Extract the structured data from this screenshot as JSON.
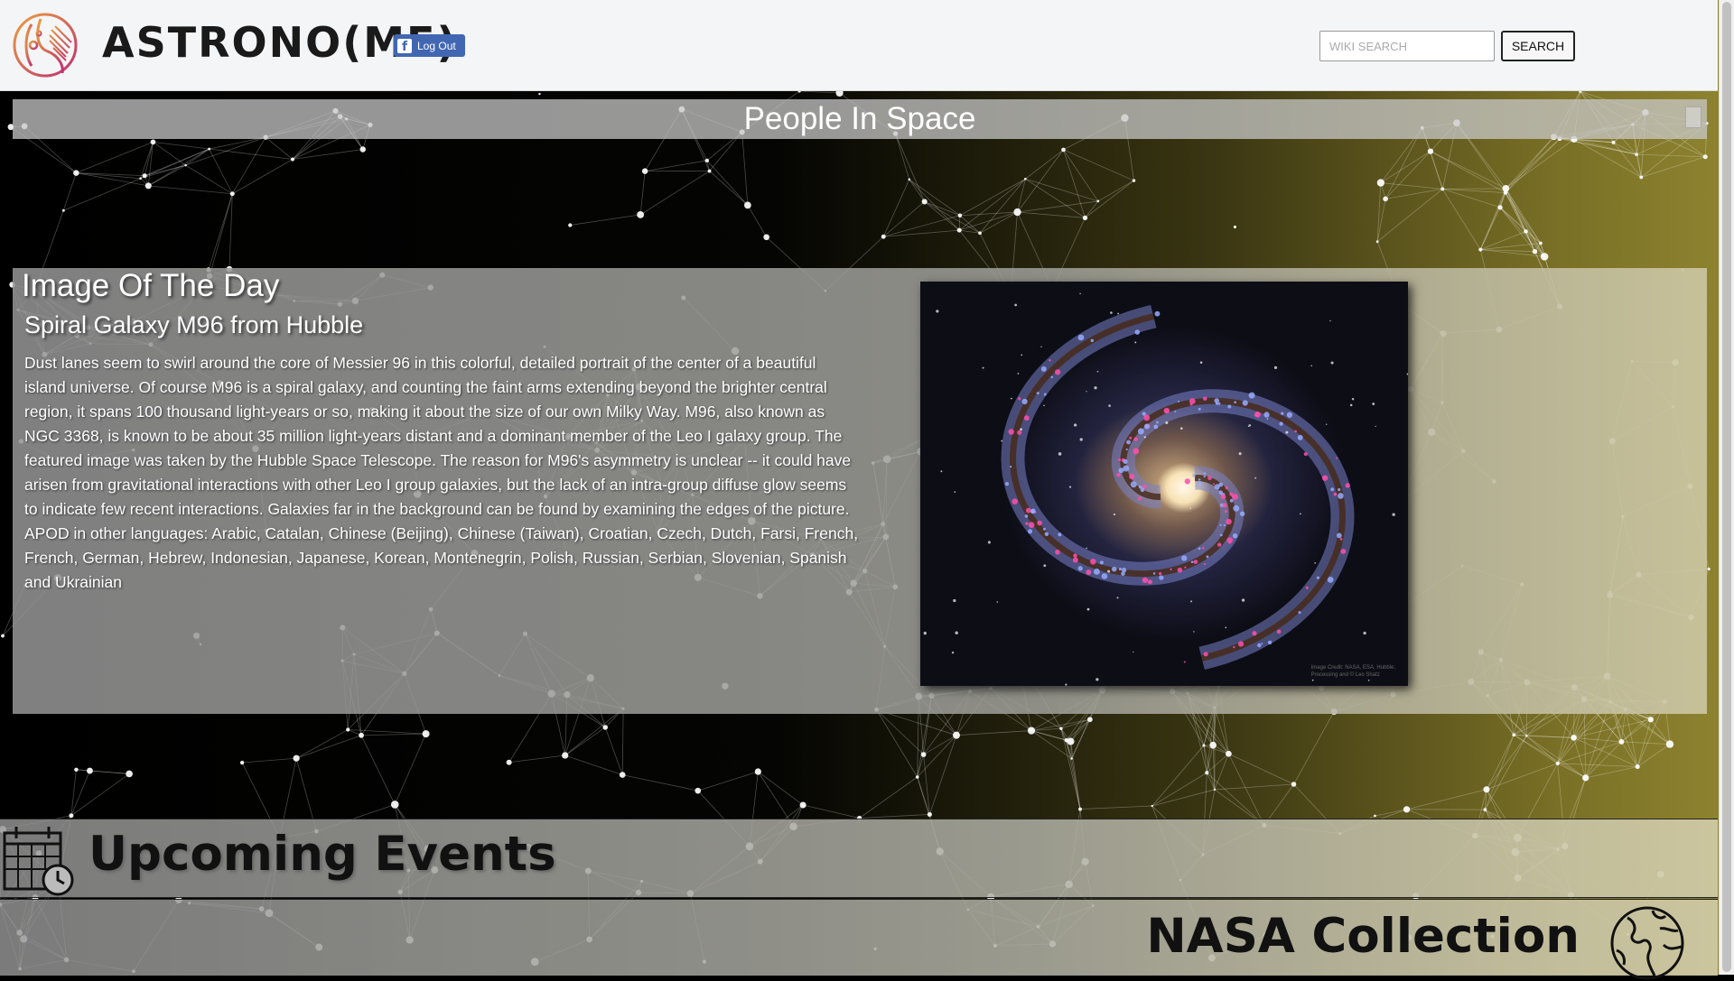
{
  "header": {
    "logo_icon": "planet-logo-icon",
    "brand": "ASTRONO(ME)",
    "facebook_button_label": "Log Out",
    "facebook_icon_glyph": "f",
    "search_placeholder": "WIKI SEARCH",
    "search_button_label": "SEARCH"
  },
  "people_in_space": {
    "title": "People In Space"
  },
  "image_of_the_day": {
    "heading": "Image Of The Day",
    "title": "Spiral Galaxy M96 from Hubble",
    "description": "Dust lanes seem to swirl around the core of Messier 96 in this colorful, detailed portrait of the center of a beautiful island universe. Of course M96 is a spiral galaxy, and counting the faint arms extending beyond the brighter central region, it spans 100 thousand light-years or so, making it about the size of our own Milky Way. M96, also known as NGC 3368, is known to be about 35 million light-years distant and a dominant member of the Leo I galaxy group. The featured image was taken by the Hubble Space Telescope. The reason for M96's asymmetry is unclear -- it could have arisen from gravitational interactions with other Leo I group galaxies, but the lack of an intra-group diffuse glow seems to indicate few recent interactions. Galaxies far in the background can be found by examining the edges of the picture. APOD in other languages: Arabic, Catalan, Chinese (Beijing), Chinese (Taiwan), Croatian, Czech, Dutch, Farsi, French, French, German, Hebrew, Indonesian, Japanese, Korean, Montenegrin, Polish, Russian, Serbian, Slovenian, Spanish and Ukrainian",
    "image_icon": "galaxy-image",
    "image_credit_line1": "Image Credit: NASA, ESA, Hubble;",
    "image_credit_line2": "Processing and © Leo Shatz"
  },
  "upcoming_events": {
    "title": "Upcoming Events",
    "icon": "calendar-clock-icon"
  },
  "nasa_collection": {
    "title": "NASA Collection",
    "icon": "globe-icon"
  },
  "colors": {
    "facebook_blue": "#4267b2",
    "header_bg": "#f4f5f6",
    "background_dark": "#000000",
    "background_olive": "#8f8430"
  }
}
